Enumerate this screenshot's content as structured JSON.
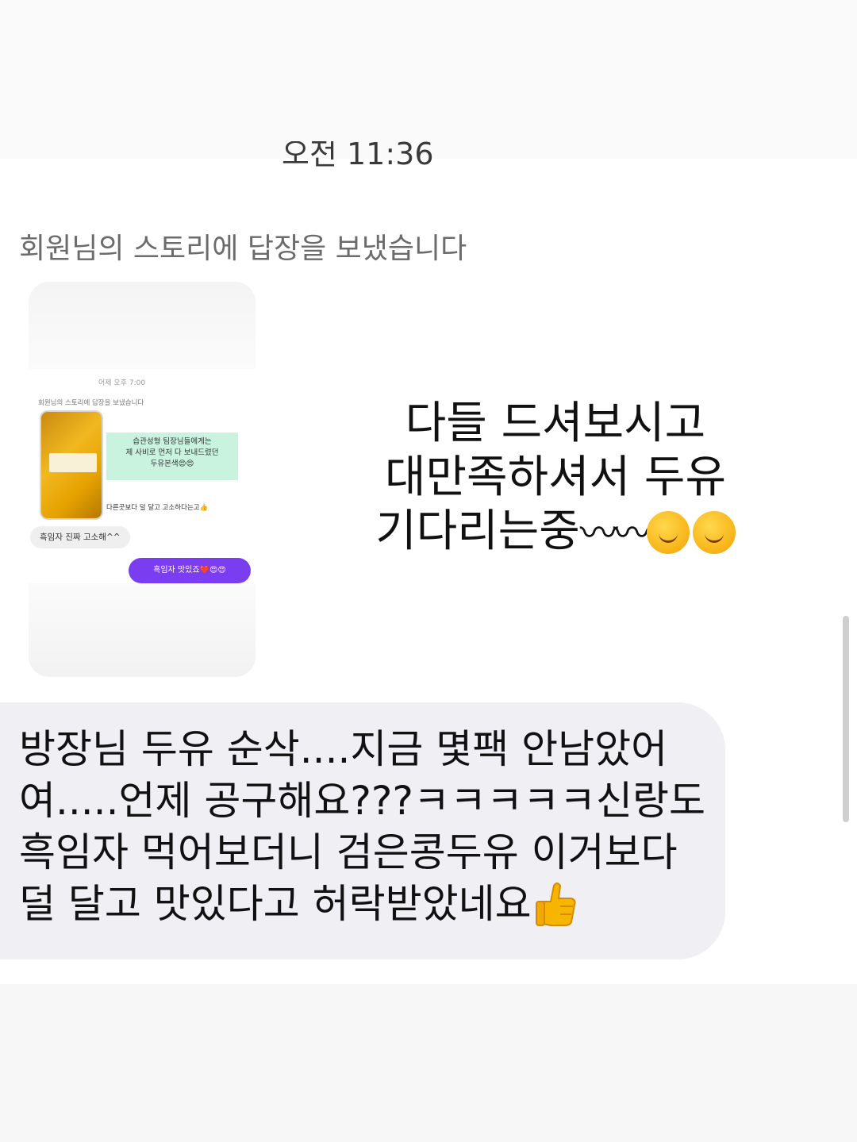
{
  "conversation": {
    "timestamp": "오전 11:36",
    "reply_note": "회원님의 스토리에 답장을 보냈습니다",
    "story_preview": {
      "time": "어제 오후 7:00",
      "reply_note": "회원님의 스토리에 답장을 보냈습니다",
      "mint_text_lines": [
        "습관성형 팀장님들에게는",
        "제 사비로 먼저 다 보내드렸던",
        "두유본색😍😍"
      ],
      "caption": "다른곳보다 덜 달고 고소하다는고👍",
      "received_message": "흑임자 진짜 고소해^^",
      "sent_message": "흑임자 맛있죠❤️😍😍"
    },
    "overlay_lines": [
      "다들 드셔보시고",
      "대만족하셔서 두유",
      "기다리는중"
    ],
    "overlay_wave": "〰〰",
    "message_lines": [
      "방장님 두유 순삭....지금 몇팩 안남았어",
      "여.....언제 공구해요???ㅋㅋㅋㅋㅋ신랑도",
      "흑임자 먹어보더니 검은콩두유 이거보다",
      "덜 달고 맛있다고 허락받았네요"
    ]
  },
  "icons": {
    "smile": "smiling-face-icon",
    "thumbs_up": "thumbs-up-icon"
  },
  "colors": {
    "sent_bubble": "#7b3df0",
    "received_bubble": "#efeff4",
    "mint_highlight": "#c9f3df"
  }
}
